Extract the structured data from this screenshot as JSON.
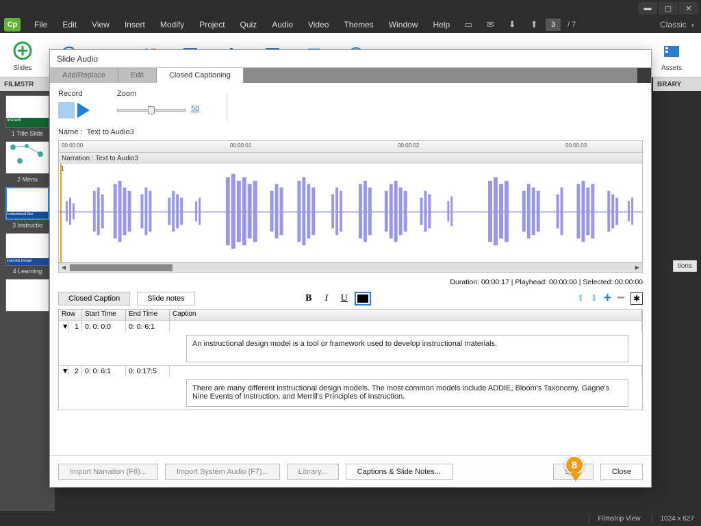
{
  "app_logo": "Cp",
  "menu": [
    "File",
    "Edit",
    "View",
    "Insert",
    "Modify",
    "Project",
    "Quiz",
    "Audio",
    "Video",
    "Themes",
    "Window",
    "Help"
  ],
  "page": {
    "current": "3",
    "of": "/   7"
  },
  "workspace": "Classic",
  "toolbar": {
    "slides": "Slides",
    "assets": "Assets"
  },
  "filmstrip_header": "FILMSTR",
  "library_header": "BRARY",
  "slides_list": [
    {
      "label": "1 Title Slide",
      "thumb_tag": "Instructi"
    },
    {
      "label": "2 Menu",
      "thumb_tag": ""
    },
    {
      "label": "3 Instructio",
      "thumb_tag": "Instructional Des"
    },
    {
      "label": "4 Learning",
      "thumb_tag": "Learning Design"
    }
  ],
  "dialog": {
    "title": "Slide Audio",
    "tabs": [
      "Add/Replace",
      "Edit",
      "Closed Captioning"
    ],
    "record_label": "Record",
    "zoom_label": "Zoom",
    "zoom_value": "50",
    "name_label": "Name :",
    "name_value": "Text to Audio3",
    "narration_label": "Narration : Text to Audio3",
    "track_marker": "1",
    "time_ruler": [
      "00:00:00",
      "00:00:01",
      "00:00:02",
      "00:00:03"
    ],
    "duration_line": "Duration:  00:00:17  |  Playhead:  00:00:00  |  Selected:  00:00:00",
    "caption_tabs": [
      "Closed Caption",
      "Slide notes"
    ],
    "table_headers": {
      "row": "Row",
      "start": "Start Time",
      "end": "End Time",
      "caption": "Caption"
    },
    "captions": [
      {
        "row": "1",
        "start": "0: 0: 0:0",
        "end": "0: 0: 6:1",
        "text": "An instructional design model is a tool or framework used to develop instructional materials."
      },
      {
        "row": "2",
        "start": "0: 0: 6:1",
        "end": "0: 0:17:5",
        "text": "There are many different instructional design models. The most common models include ADDIE, Bloom's Taxonomy, Gagne's Nine Events of Instruction, and Merrill's Principles of Instruction."
      }
    ],
    "footer": {
      "import_narration": "Import Narration (F6)...",
      "import_system": "Import System Audio (F7)...",
      "library": "Library...",
      "captions_notes": "Captions & Slide Notes...",
      "save": "Save",
      "close": "Close"
    }
  },
  "callout_number": "8",
  "status": {
    "view": "Filmstrip View",
    "dims": "1024 x 627"
  },
  "right_hint": "tions"
}
